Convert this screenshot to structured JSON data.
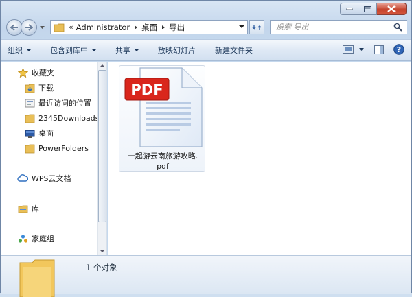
{
  "window": {
    "caption_buttons": [
      "minimize",
      "maximize",
      "close"
    ]
  },
  "address": {
    "root_chevron": "«",
    "segments": [
      "Administrator",
      "桌面",
      "导出"
    ]
  },
  "search": {
    "placeholder": "搜索 导出"
  },
  "toolbar": {
    "organize": "组织",
    "include_in_library": "包含到库中",
    "share": "共享",
    "slideshow": "放映幻灯片",
    "new_folder": "新建文件夹"
  },
  "nav_pane": {
    "favorites": "收藏夹",
    "favorites_items": [
      "下载",
      "最近访问的位置",
      "2345Downloads",
      "桌面",
      "PowerFolders"
    ],
    "wps_cloud": "WPS云文档",
    "library": "库",
    "homegroup": "家庭组"
  },
  "files": [
    {
      "icon_badge": "PDF",
      "name_line1": "一起游云南旅游攻略.",
      "name_line2": "pdf"
    }
  ],
  "details": {
    "count": "1 个对象"
  },
  "colors": {
    "pdf_red": "#d9261c",
    "folder_yellow": "#f2c75c",
    "close_red": "#c5432d",
    "toolbar_text": "#1e395b"
  }
}
